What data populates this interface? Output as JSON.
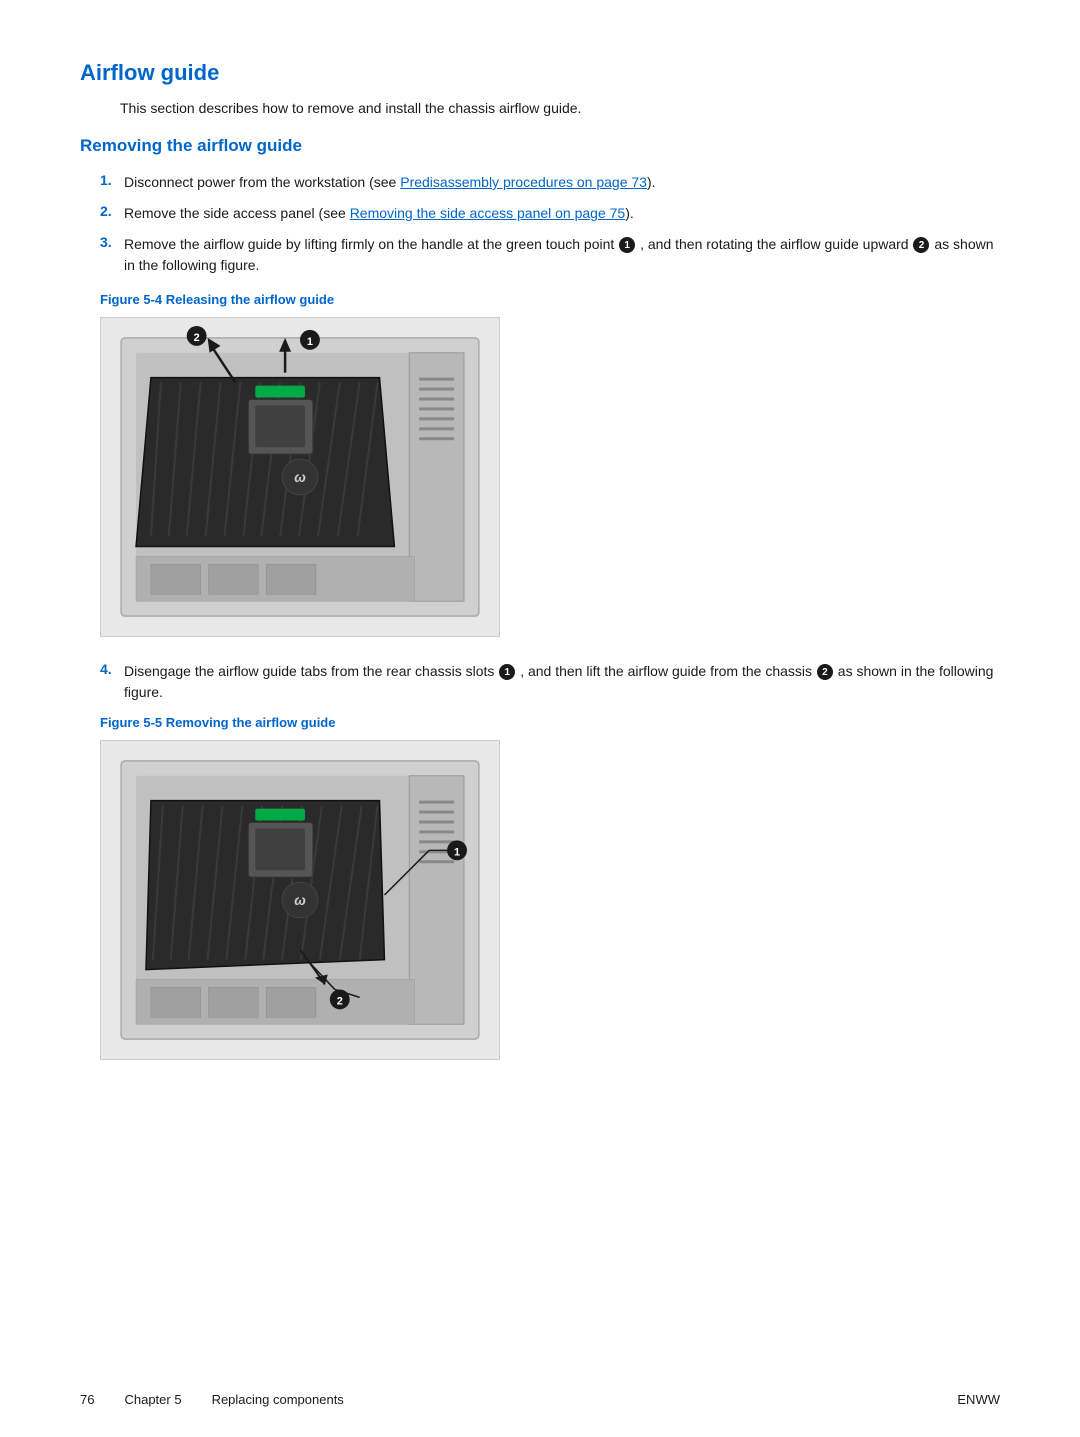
{
  "page": {
    "title": "Airflow guide",
    "intro": "This section describes how to remove and install the chassis airflow guide.",
    "subsection_title": "Removing the airflow guide",
    "steps": [
      {
        "number": "1.",
        "text": "Disconnect power from the workstation (see ",
        "link_text": "Predisassembly procedures on page 73",
        "text_after": ")."
      },
      {
        "number": "2.",
        "text": "Remove the side access panel (see ",
        "link_text": "Removing the side access panel on page 75",
        "text_after": ")."
      },
      {
        "number": "3.",
        "text_full": "Remove the airflow guide by lifting firmly on the handle at the green touch point",
        "circle1": "1",
        "text_mid": ", and then rotating the airflow guide upward",
        "circle2": "2",
        "text_end": "as shown in the following figure."
      }
    ],
    "figure1_label": "Figure 5-4",
    "figure1_caption": "  Releasing the airflow guide",
    "step4": {
      "number": "4.",
      "text_start": "Disengage the airflow guide tabs from the rear chassis slots",
      "circle1": "1",
      "text_mid": ", and then lift the airflow guide from the chassis",
      "circle2": "2",
      "text_end": "as shown in the following figure."
    },
    "figure2_label": "Figure 5-5",
    "figure2_caption": "  Removing the airflow guide",
    "footer": {
      "page_num": "76",
      "chapter": "Chapter 5",
      "chapter_title": "Replacing components",
      "right_label": "ENWW"
    }
  }
}
